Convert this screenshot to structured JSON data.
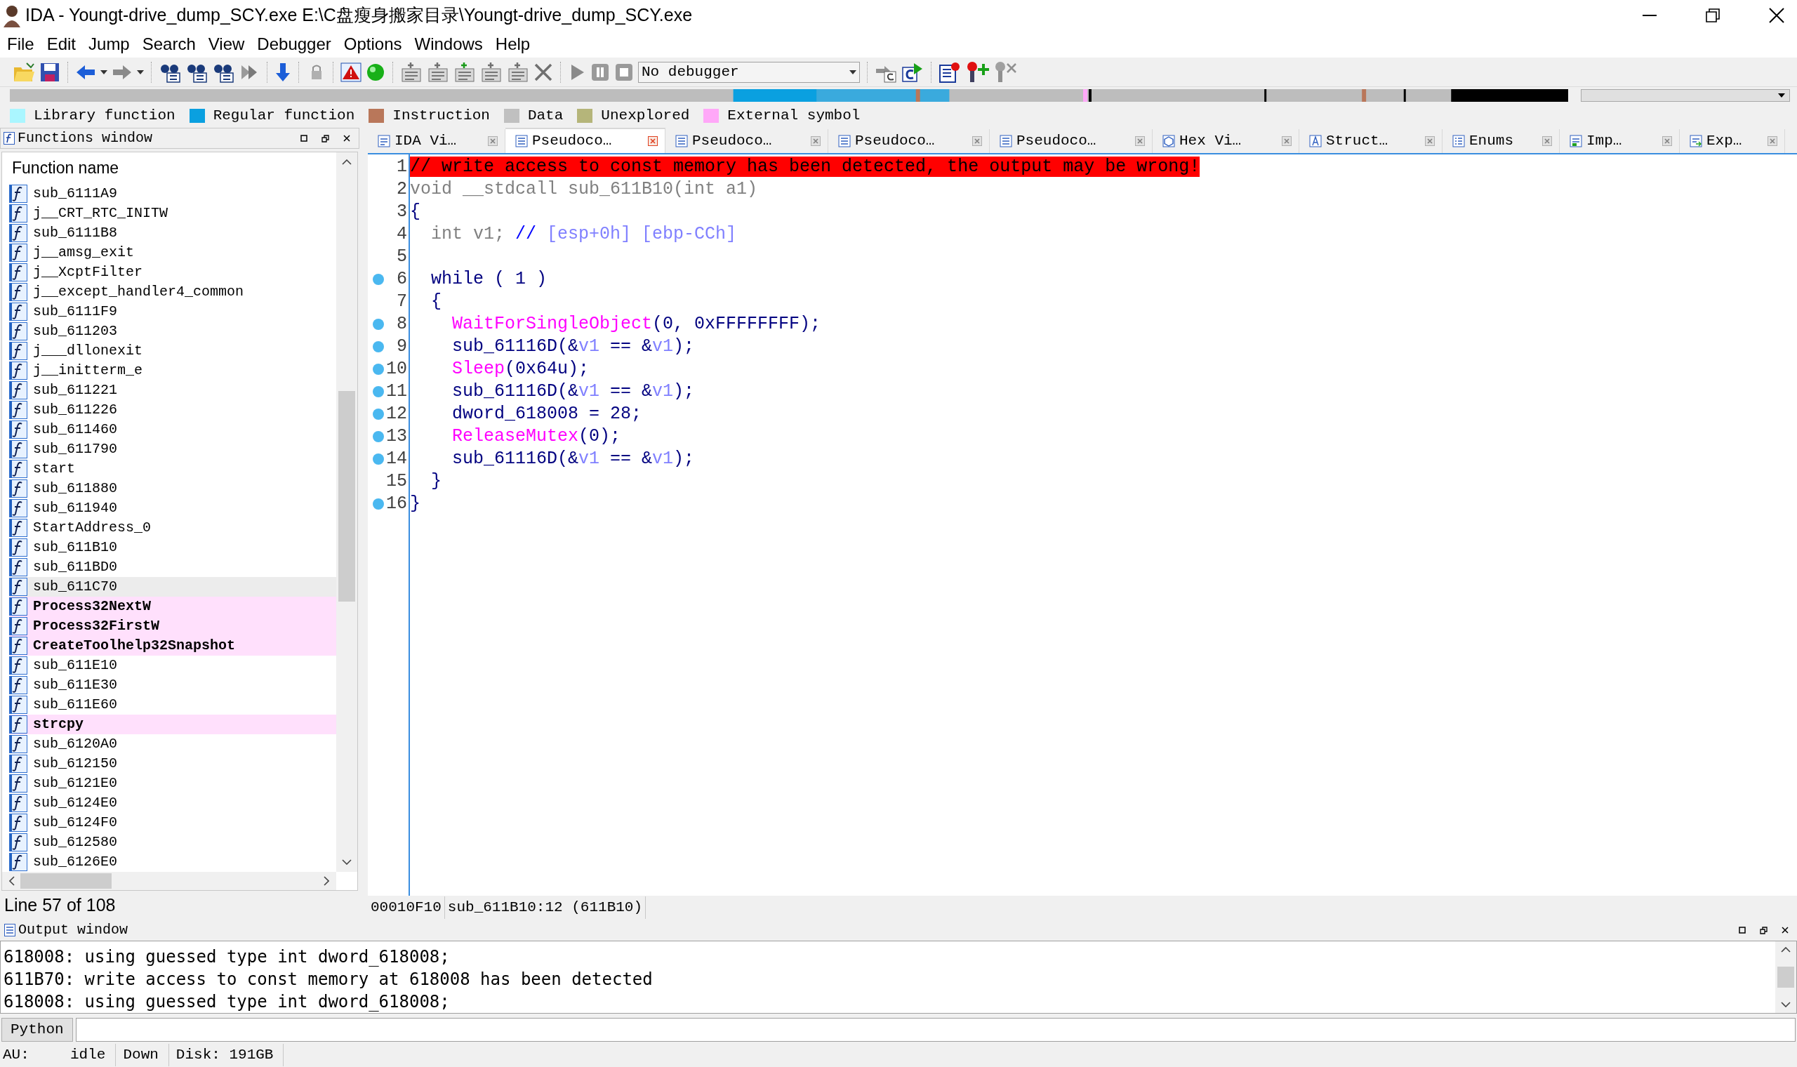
{
  "window": {
    "title": "IDA - Youngt-drive_dump_SCY.exe E:\\C盘瘦身搬家目录\\Youngt-drive_dump_SCY.exe"
  },
  "menu": [
    "File",
    "Edit",
    "Jump",
    "Search",
    "View",
    "Debugger",
    "Options",
    "Windows",
    "Help"
  ],
  "toolbar": {
    "debugger_select": "No debugger"
  },
  "legend": [
    {
      "label": "Library function",
      "color": "#aaf6ff"
    },
    {
      "label": "Regular function",
      "color": "#0aa0e0"
    },
    {
      "label": "Instruction",
      "color": "#b9775a"
    },
    {
      "label": "Data",
      "color": "#c0c0c0"
    },
    {
      "label": "Unexplored",
      "color": "#b5b57a"
    },
    {
      "label": "External symbol",
      "color": "#ffa8f8"
    }
  ],
  "functions_window": {
    "title": "Functions window",
    "column": "Function name",
    "status": "Line 57 of 108",
    "rows": [
      {
        "name": "sub_6111A9",
        "kind": "regular",
        "selected": false
      },
      {
        "name": "j__CRT_RTC_INITW",
        "kind": "regular",
        "selected": false
      },
      {
        "name": "sub_6111B8",
        "kind": "regular",
        "selected": false
      },
      {
        "name": "j__amsg_exit",
        "kind": "regular",
        "selected": false
      },
      {
        "name": "j__XcptFilter",
        "kind": "regular",
        "selected": false
      },
      {
        "name": "j__except_handler4_common",
        "kind": "regular",
        "selected": false
      },
      {
        "name": "sub_6111F9",
        "kind": "regular",
        "selected": false
      },
      {
        "name": "sub_611203",
        "kind": "regular",
        "selected": false
      },
      {
        "name": "j___dllonexit",
        "kind": "regular",
        "selected": false
      },
      {
        "name": "j__initterm_e",
        "kind": "regular",
        "selected": false
      },
      {
        "name": "sub_611221",
        "kind": "regular",
        "selected": false
      },
      {
        "name": "sub_611226",
        "kind": "regular",
        "selected": false
      },
      {
        "name": "sub_611460",
        "kind": "regular",
        "selected": false
      },
      {
        "name": "sub_611790",
        "kind": "regular",
        "selected": false
      },
      {
        "name": "start",
        "kind": "regular",
        "selected": false
      },
      {
        "name": "sub_611880",
        "kind": "regular",
        "selected": false
      },
      {
        "name": "sub_611940",
        "kind": "regular",
        "selected": false
      },
      {
        "name": "StartAddress_0",
        "kind": "regular",
        "selected": false
      },
      {
        "name": "sub_611B10",
        "kind": "regular",
        "selected": false
      },
      {
        "name": "sub_611BD0",
        "kind": "regular",
        "selected": false
      },
      {
        "name": "sub_611C70",
        "kind": "regular",
        "selected": true
      },
      {
        "name": "Process32NextW",
        "kind": "external",
        "selected": false
      },
      {
        "name": "Process32FirstW",
        "kind": "external",
        "selected": false
      },
      {
        "name": "CreateToolhelp32Snapshot",
        "kind": "external",
        "selected": false
      },
      {
        "name": "sub_611E10",
        "kind": "regular",
        "selected": false
      },
      {
        "name": "sub_611E30",
        "kind": "regular",
        "selected": false
      },
      {
        "name": "sub_611E60",
        "kind": "regular",
        "selected": false
      },
      {
        "name": "strcpy",
        "kind": "external",
        "selected": false
      },
      {
        "name": "sub_6120A0",
        "kind": "regular",
        "selected": false
      },
      {
        "name": "sub_612150",
        "kind": "regular",
        "selected": false
      },
      {
        "name": "sub_6121E0",
        "kind": "regular",
        "selected": false
      },
      {
        "name": "sub_6124E0",
        "kind": "regular",
        "selected": false
      },
      {
        "name": "sub_6124F0",
        "kind": "regular",
        "selected": false
      },
      {
        "name": "sub_612580",
        "kind": "regular",
        "selected": false
      },
      {
        "name": "sub_6126E0",
        "kind": "regular",
        "selected": false
      }
    ]
  },
  "tabs": [
    {
      "label": "IDA Vi…",
      "kind": "disasm",
      "selected": false
    },
    {
      "label": "Pseudoco…",
      "kind": "pseudo",
      "selected": true
    },
    {
      "label": "Pseudoco…",
      "kind": "pseudo",
      "selected": false
    },
    {
      "label": "Pseudoco…",
      "kind": "pseudo",
      "selected": false
    },
    {
      "label": "Pseudoco…",
      "kind": "pseudo",
      "selected": false
    },
    {
      "label": "Hex Vi…",
      "kind": "hex",
      "selected": false
    },
    {
      "label": "Struct…",
      "kind": "struct",
      "selected": false
    },
    {
      "label": "Enums",
      "kind": "enums",
      "selected": false
    },
    {
      "label": "Imp…",
      "kind": "imports",
      "selected": false
    },
    {
      "label": "Exp…",
      "kind": "exports",
      "selected": false
    }
  ],
  "code": [
    {
      "number": "1",
      "breakpoint": false,
      "tokens": [
        {
          "text": "// write access to const memory has been detected, the output may be wrong!",
          "kind": "warning"
        }
      ]
    },
    {
      "number": "2",
      "breakpoint": false,
      "tokens": [
        {
          "text": "void __stdcall sub_611B10(int a1)",
          "kind": "decl"
        }
      ]
    },
    {
      "number": "3",
      "breakpoint": false,
      "tokens": [
        {
          "text": "{",
          "kind": "code"
        }
      ]
    },
    {
      "number": "4",
      "breakpoint": false,
      "tokens": [
        {
          "text": "  int v1;",
          "kind": "decl"
        },
        {
          "text": " //",
          "kind": "comment"
        },
        {
          "text": " [esp+0h] [ebp-CCh]",
          "kind": "var"
        }
      ]
    },
    {
      "number": "5",
      "breakpoint": false
    },
    {
      "number": "6",
      "breakpoint": true,
      "tokens": [
        {
          "text": "  while ( 1 )",
          "kind": "code"
        }
      ]
    },
    {
      "number": "7",
      "breakpoint": false,
      "tokens": [
        {
          "text": "  {",
          "kind": "code"
        }
      ]
    },
    {
      "number": "8",
      "breakpoint": true,
      "tokens": [
        {
          "text": "    WaitForSingleObject",
          "kind": "import"
        },
        {
          "text": "(0, 0xFFFFFFFF);",
          "kind": "code"
        }
      ]
    },
    {
      "number": "9",
      "breakpoint": true,
      "tokens": [
        {
          "text": "    sub_61116D(&",
          "kind": "code"
        },
        {
          "text": "v1",
          "kind": "var"
        },
        {
          "text": " == &",
          "kind": "code"
        },
        {
          "text": "v1",
          "kind": "var"
        },
        {
          "text": ");",
          "kind": "code"
        }
      ]
    },
    {
      "number": "10",
      "breakpoint": true,
      "tokens": [
        {
          "text": "    Sleep",
          "kind": "import"
        },
        {
          "text": "(0x64u);",
          "kind": "code"
        }
      ]
    },
    {
      "number": "11",
      "breakpoint": true,
      "tokens": [
        {
          "text": "    sub_61116D(&",
          "kind": "code"
        },
        {
          "text": "v1",
          "kind": "var"
        },
        {
          "text": " == &",
          "kind": "code"
        },
        {
          "text": "v1",
          "kind": "var"
        },
        {
          "text": ");",
          "kind": "code"
        }
      ]
    },
    {
      "number": "12",
      "breakpoint": true,
      "tokens": [
        {
          "text": "    dword_618008 = 28;",
          "kind": "code"
        }
      ]
    },
    {
      "number": "13",
      "breakpoint": true,
      "tokens": [
        {
          "text": "    ReleaseMutex",
          "kind": "import"
        },
        {
          "text": "(0);",
          "kind": "code"
        }
      ]
    },
    {
      "number": "14",
      "breakpoint": true,
      "tokens": [
        {
          "text": "    sub_61116D(&",
          "kind": "code"
        },
        {
          "text": "v1",
          "kind": "var"
        },
        {
          "text": " == &",
          "kind": "code"
        },
        {
          "text": "v1",
          "kind": "var"
        },
        {
          "text": ");",
          "kind": "code"
        }
      ]
    },
    {
      "number": "15",
      "breakpoint": false,
      "tokens": [
        {
          "text": "  }",
          "kind": "code"
        }
      ]
    },
    {
      "number": "16",
      "breakpoint": true,
      "tokens": [
        {
          "text": "}",
          "kind": "code"
        }
      ]
    }
  ],
  "code_status": [
    "00010F10",
    "sub_611B10:12 (611B10)"
  ],
  "output_window": {
    "title": "Output window",
    "lines": [
      "618008: using guessed type int dword_618008;",
      "611B70: write access to const memory at 618008 has been detected",
      "618008: using guessed type int dword_618008;"
    ],
    "python_button": "Python"
  },
  "status_bar": [
    "AU:",
    "idle",
    "Down",
    "Disk: 191GB"
  ]
}
